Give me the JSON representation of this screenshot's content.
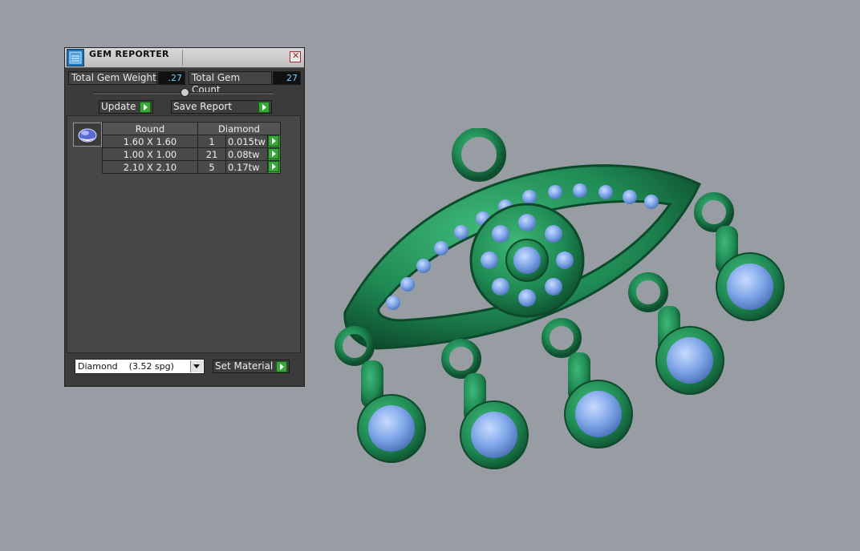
{
  "window": {
    "title": "GEM REPORTER",
    "close_glyph": "✕"
  },
  "totals": {
    "weight_label": "Total Gem Weight",
    "weight_value": ".27",
    "count_label": "Total Gem Count",
    "count_value": "27"
  },
  "toolbar": {
    "update_label": "Update",
    "save_report_label": "Save Report"
  },
  "gem_table": {
    "headers": [
      "Round",
      "Diamond"
    ],
    "rows": [
      {
        "size": "1.60 X 1.60",
        "count": "1",
        "weight": "0.015tw"
      },
      {
        "size": "1.00 X 1.00",
        "count": "21",
        "weight": "0.08tw"
      },
      {
        "size": "2.10 X 2.10",
        "count": "5",
        "weight": "0.17tw"
      }
    ]
  },
  "material": {
    "selected": "Diamond    (3.52 spg)",
    "set_label": "Set Material"
  },
  "colors": {
    "metal": "#1f8a54",
    "gem": "#7fa6e8",
    "accent_button": "#3aa63a",
    "background": "#979da2"
  },
  "icons": [
    "gem-reporter-app-icon",
    "close-icon",
    "round-gem-icon",
    "play-arrow-icon",
    "dropdown-arrow-icon"
  ]
}
